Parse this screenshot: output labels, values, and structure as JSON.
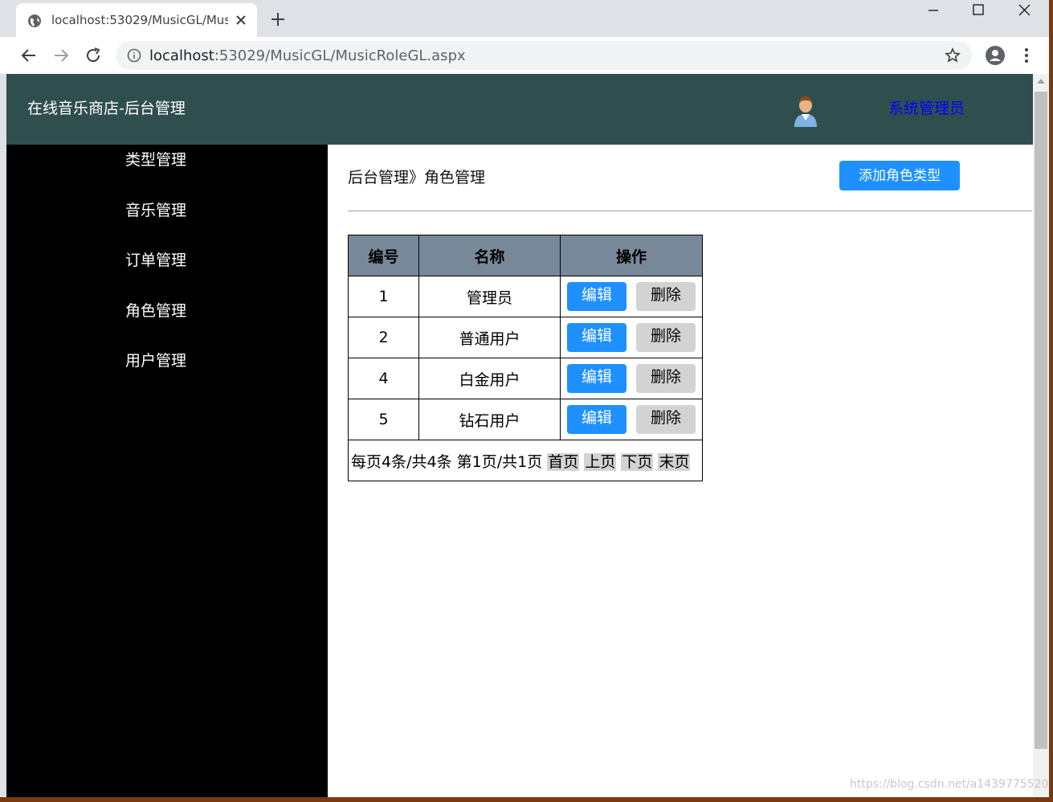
{
  "browser": {
    "tab_title": "localhost:53029/MusicGL/Mus",
    "url_host": "localhost",
    "url_path": ":53029/MusicGL/MusicRoleGL.aspx"
  },
  "header": {
    "site_title": "在线音乐商店-后台管理",
    "admin_label": "系统管理员"
  },
  "sidebar": {
    "items": [
      {
        "label": "类型管理"
      },
      {
        "label": "音乐管理"
      },
      {
        "label": "订单管理"
      },
      {
        "label": "角色管理"
      },
      {
        "label": "用户管理"
      }
    ]
  },
  "main": {
    "breadcrumb": "后台管理》角色管理",
    "add_button": "添加角色类型",
    "table": {
      "headers": [
        "编号",
        "名称",
        "操作"
      ],
      "edit_label": "编辑",
      "delete_label": "删除",
      "rows": [
        {
          "id": "1",
          "name": "管理员"
        },
        {
          "id": "2",
          "name": "普通用户"
        },
        {
          "id": "4",
          "name": "白金用户"
        },
        {
          "id": "5",
          "name": "钻石用户"
        }
      ],
      "pager": {
        "summary": "每页4条/共4条 第1页/共1页",
        "first": "首页",
        "prev": "上页",
        "next": "下页",
        "last": "末页"
      }
    }
  },
  "watermark": "https://blog.csdn.net/a1439775520",
  "colors": {
    "header_bg": "#2f4f4f",
    "sidebar_bg": "#000000",
    "accent": "#1e90ff",
    "table_header_bg": "#778899",
    "admin_link": "#0000ff"
  }
}
